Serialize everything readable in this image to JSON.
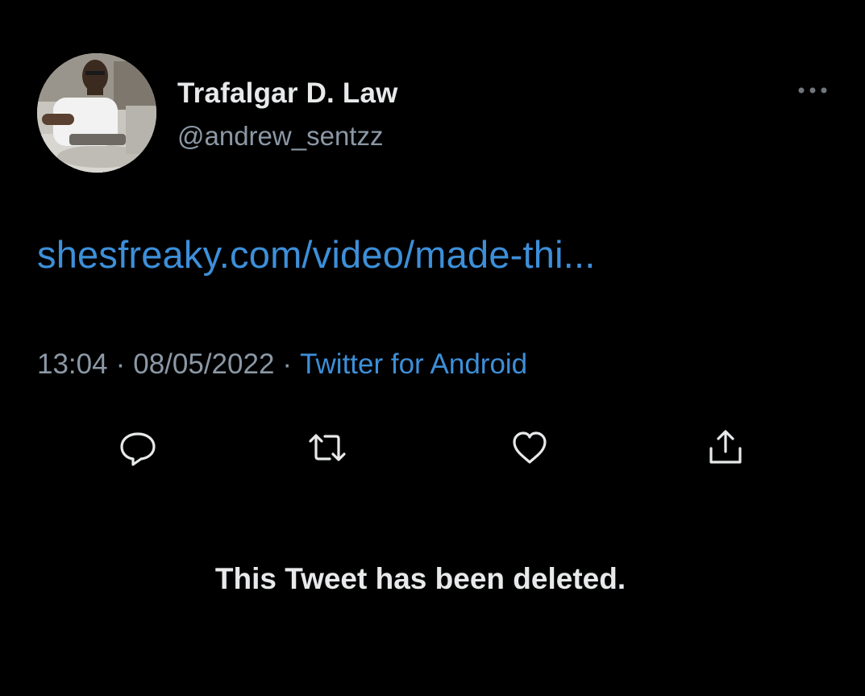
{
  "tweet": {
    "author": {
      "display_name": "Trafalgar D. Law",
      "handle": "@andrew_sentzz"
    },
    "link_text": "shesfreaky.com/video/made-thi...",
    "time": "13:04",
    "date": "08/05/2022",
    "separator": "·",
    "source": "Twitter for Android",
    "deleted_notice": "This Tweet has been deleted."
  },
  "icons": {
    "more": "more-horizontal-icon",
    "reply": "reply-icon",
    "retweet": "retweet-icon",
    "like": "heart-icon",
    "share": "share-icon"
  },
  "colors": {
    "background": "#000000",
    "text": "#e7e9ea",
    "secondary": "#8b98a5",
    "link": "#3d8fd9"
  }
}
